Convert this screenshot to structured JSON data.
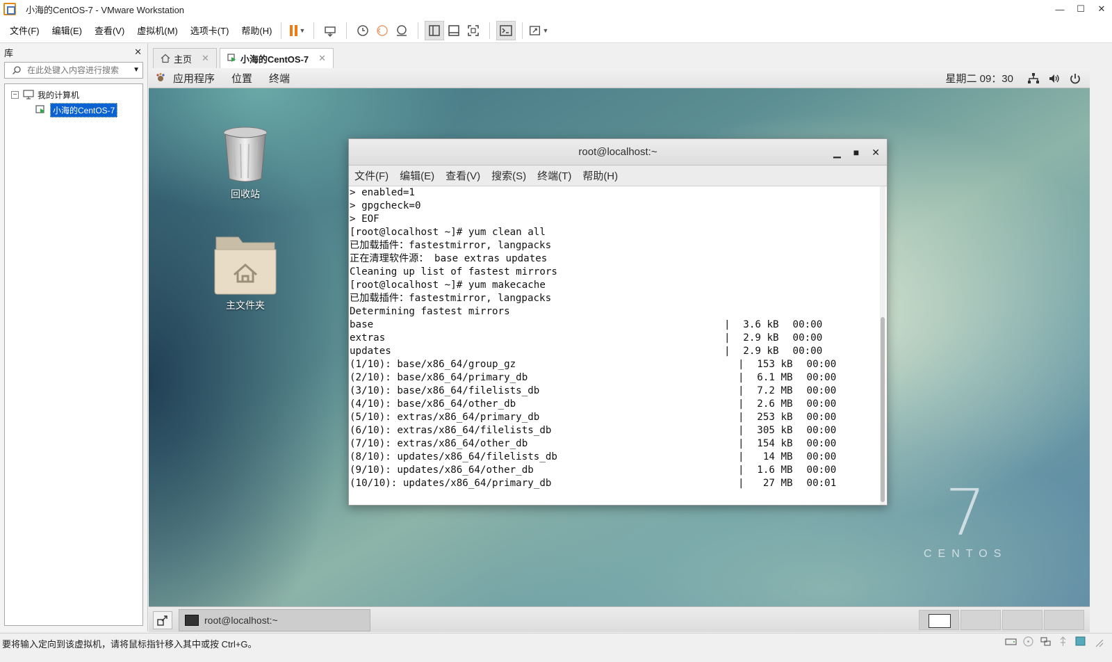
{
  "window": {
    "title": "小海的CentOS-7 - VMware Workstation",
    "controls": [
      "—",
      "☐",
      "✕"
    ]
  },
  "menubar": {
    "items": [
      "文件(F)",
      "编辑(E)",
      "查看(V)",
      "虚拟机(M)",
      "选项卡(T)",
      "帮助(H)"
    ]
  },
  "library": {
    "title": "库",
    "close": "✕",
    "search_placeholder": "在此处键入内容进行搜索",
    "tree": {
      "root": "我的计算机",
      "root_toggle": "⊟",
      "child": "小海的CentOS-7"
    }
  },
  "tabs": [
    {
      "label": "主页",
      "close": "✕"
    },
    {
      "label": "小海的CentOS-7",
      "close": "✕"
    }
  ],
  "guest_top": {
    "menus": [
      "应用程序",
      "位置",
      "终端"
    ],
    "clock": "星期二 09：30"
  },
  "desktop": {
    "icons": [
      {
        "label": "回收站",
        "icon": "trash-icon"
      },
      {
        "label": "主文件夹",
        "icon": "home-folder-icon"
      }
    ],
    "logo_number": "7",
    "logo_word": "CENTOS"
  },
  "terminal": {
    "title": "root@localhost:~",
    "menus": [
      "文件(F)",
      "编辑(E)",
      "查看(V)",
      "搜索(S)",
      "终端(T)",
      "帮助(H)"
    ],
    "lines": [
      "> enabled=1",
      "> gpgcheck=0",
      "> EOF",
      "[root@localhost ~]# yum clean all",
      "已加载插件：fastestmirror, langpacks",
      "正在清理软件源： base extras updates",
      "Cleaning up list of fastest mirrors",
      "[root@localhost ~]# yum makecache",
      "已加载插件：fastestmirror, langpacks",
      "Determining fastest mirrors"
    ],
    "repos": [
      {
        "name": "base",
        "size": "3.6 kB",
        "time": "00:00"
      },
      {
        "name": "extras",
        "size": "2.9 kB",
        "time": "00:00"
      },
      {
        "name": "updates",
        "size": "2.9 kB",
        "time": "00:00"
      }
    ],
    "downloads": [
      {
        "name": "(1/10): base/x86_64/group_gz",
        "size": "153 kB",
        "time": "00:00"
      },
      {
        "name": "(2/10): base/x86_64/primary_db",
        "size": "6.1 MB",
        "time": "00:00"
      },
      {
        "name": "(3/10): base/x86_64/filelists_db",
        "size": "7.2 MB",
        "time": "00:00"
      },
      {
        "name": "(4/10): base/x86_64/other_db",
        "size": "2.6 MB",
        "time": "00:00"
      },
      {
        "name": "(5/10): extras/x86_64/primary_db",
        "size": "253 kB",
        "time": "00:00"
      },
      {
        "name": "(6/10): extras/x86_64/filelists_db",
        "size": "305 kB",
        "time": "00:00"
      },
      {
        "name": "(7/10): extras/x86_64/other_db",
        "size": "154 kB",
        "time": "00:00"
      },
      {
        "name": "(8/10): updates/x86_64/filelists_db",
        "size": "14 MB",
        "time": "00:00"
      },
      {
        "name": "(9/10): updates/x86_64/other_db",
        "size": "1.6 MB",
        "time": "00:00"
      },
      {
        "name": "(10/10): updates/x86_64/primary_db",
        "size": "27 MB",
        "time": "00:01"
      }
    ]
  },
  "taskbar": {
    "task_label": "root@localhost:~"
  },
  "statusbar": {
    "message": "要将输入定向到该虚拟机，请将鼠标指针移入其中或按 Ctrl+G。"
  }
}
